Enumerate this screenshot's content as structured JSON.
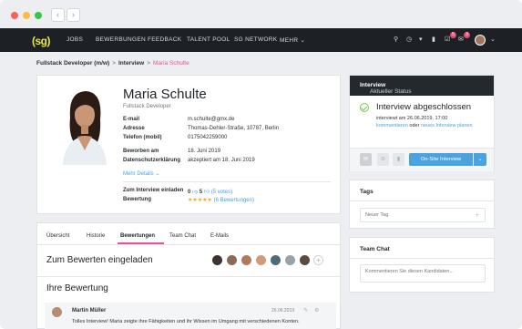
{
  "nav": {
    "logo": "(sg)",
    "links": [
      "JOBS",
      "BEWERBUNGEN",
      "FEEDBACK",
      "TALENT POOL",
      "SG NETWORK",
      "MEHR"
    ],
    "badges": [
      "5",
      "3"
    ],
    "colors": {
      "bar": "#1d2126",
      "accent_pink": "#e5539a",
      "accent_blue": "#4aa3df",
      "success": "#7dc64b"
    }
  },
  "breadcrumb": [
    "Fullstack Developer (m/w)",
    "Interview",
    "Maria Schulte"
  ],
  "profile": {
    "name": "Maria Schulte",
    "role": "Fullstack Developer",
    "email_label": "E-mail",
    "email": "m.schulte@gmx.de",
    "address_label": "Adresse",
    "address": "Thomas-Dehler-Straße, 10787, Berlin",
    "phone_label": "Telefon (mobil)",
    "phone": "0175042259000",
    "applied_label": "Beworben am",
    "applied": "18. Juni 2019",
    "privacy_label": "Datenschutzerklärung",
    "privacy": "akzeptiert am 18. Juni 2019",
    "more": "Mehr Details",
    "invite_label": "Zum Interview einladen",
    "invite_no": "0",
    "invite_yes": "5",
    "invite_votes": "(5 votes)",
    "rating_label": "Bewertung",
    "stars": "★★★★★",
    "rating_count": "(6 Bewertungen)"
  },
  "tabs": [
    "Übersicht",
    "Historie",
    "Bewertungen",
    "Team Chat",
    "E-Mails"
  ],
  "reviews": {
    "invite_heading": "Zum Bewerten eingeladen",
    "own_heading": "Ihre Bewertung",
    "item": {
      "author": "Martin Müller",
      "date": "26.06.2019",
      "text": "Tolles Interview! Maria zeigte ihre Fähigkeiten und ihr Wissen im Umgang mit verschiedenen Konten."
    }
  },
  "status": {
    "header_label": "Aktueller Status",
    "header_value": "Interview",
    "title": "Interview abgeschlossen",
    "line1": "interviewt am 26.06.2019, 17:00",
    "link1": "kommentieren",
    "or": "oder",
    "link2": "neues Interview planen",
    "primary_button": "On-Site Interview"
  },
  "tags": {
    "title": "Tags",
    "placeholder": "Neuer Tag"
  },
  "chat": {
    "title": "Team Chat",
    "placeholder": "Kommentieren Sie diesen Kandidaten..."
  }
}
